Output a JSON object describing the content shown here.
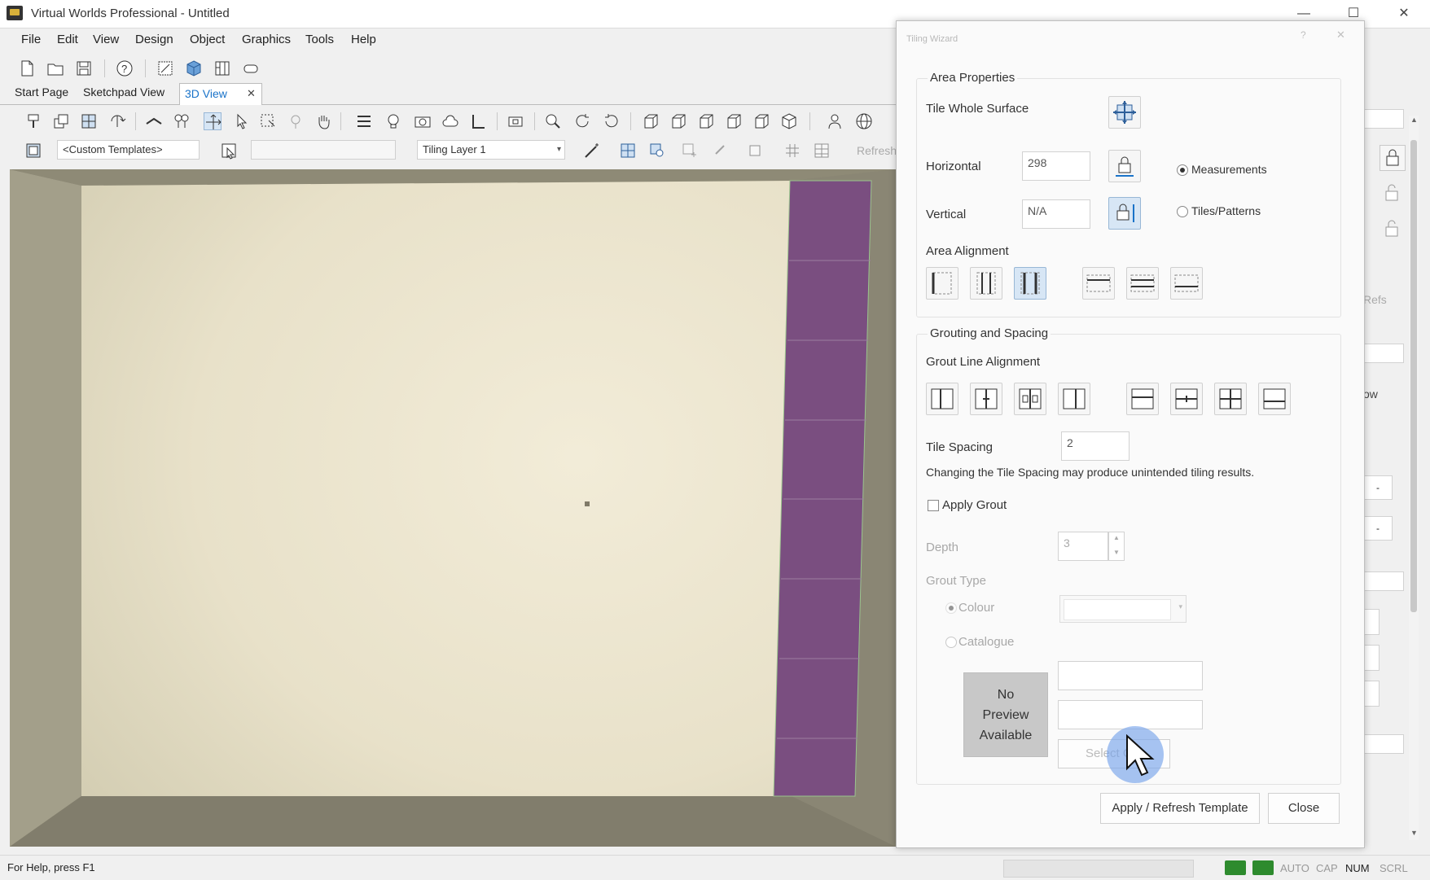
{
  "window": {
    "title": "Virtual Worlds Professional - Untitled",
    "minimize": "—",
    "maximize": "☐",
    "close": "✕"
  },
  "menu": [
    "File",
    "Edit",
    "View",
    "Design",
    "Object",
    "Graphics",
    "Tools",
    "Help"
  ],
  "tabs": {
    "start": "Start Page",
    "sketchpad": "Sketchpad View",
    "view3d": "3D View",
    "close": "✕"
  },
  "toolbar3": {
    "templates": "<Custom Templates>",
    "layer": "Tiling Layer 1",
    "refresh": "Refresh"
  },
  "dialog": {
    "title": "Tiling Wizard",
    "help": "?",
    "close_x": "✕",
    "area_properties": {
      "heading": "Area Properties",
      "tile_whole_surface": "Tile Whole Surface",
      "horizontal_label": "Horizontal",
      "horizontal_value": "298",
      "vertical_label": "Vertical",
      "vertical_value": "N/A",
      "measurements": "Measurements",
      "tiles_patterns": "Tiles/Patterns",
      "area_alignment": "Area Alignment"
    },
    "grouting": {
      "heading": "Grouting and Spacing",
      "grout_line_alignment": "Grout Line Alignment",
      "tile_spacing_label": "Tile Spacing",
      "tile_spacing_value": "2",
      "warning": "Changing the Tile Spacing may produce unintended tiling results.",
      "apply_grout": "Apply Grout",
      "depth_label": "Depth",
      "depth_value": "3",
      "grout_type": "Grout Type",
      "colour": "Colour",
      "catalogue": "Catalogue",
      "no_preview_1": "No",
      "no_preview_2": "Preview",
      "no_preview_3": "Available",
      "select_button": "Select G..."
    },
    "apply_button": "Apply / Refresh Template",
    "close_button": "Close"
  },
  "right_panel": {
    "refs": "Refs",
    "ow": "ow",
    "dash1": "-",
    "dash2": "-"
  },
  "status": {
    "help": "For Help, press F1",
    "indicators": [
      {
        "label": "AUTO",
        "on": false
      },
      {
        "label": "CAP",
        "on": false
      },
      {
        "label": "NUM",
        "on": true
      },
      {
        "label": "SCRL",
        "on": false
      }
    ]
  },
  "colors": {
    "accent": "#1a73c9",
    "tile": "#7a4e80",
    "wall": "#f2ecd8",
    "dialog_bg": "#fafafa"
  }
}
